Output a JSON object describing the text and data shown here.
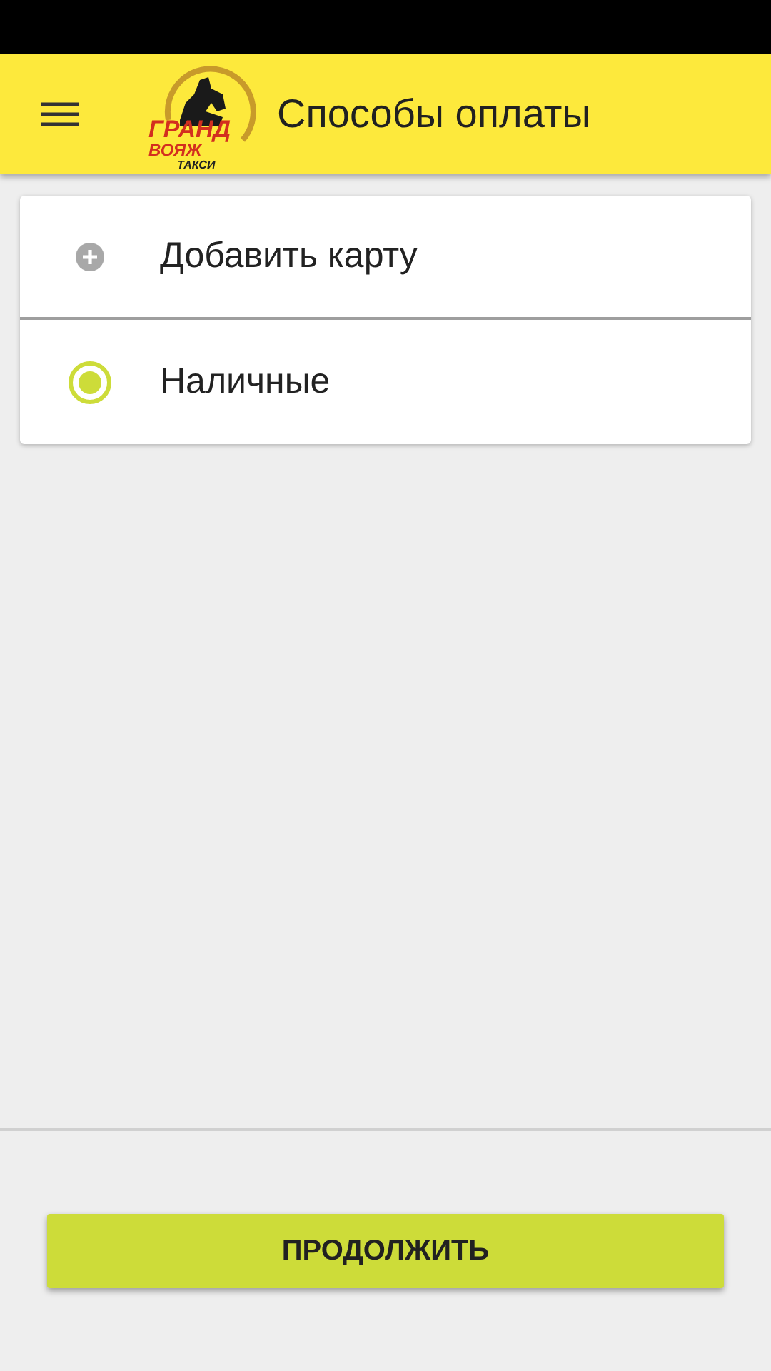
{
  "header": {
    "title": "Способы оплаты",
    "logo": {
      "line_1": "ГРАНД",
      "line_2": "ВОЯЖ",
      "line_3": "ТАКСИ"
    }
  },
  "payment_methods": [
    {
      "kind": "add",
      "label": "Добавить карту"
    },
    {
      "kind": "radio",
      "label": "Наличные",
      "selected": true
    }
  ],
  "continue_button": "ПРОДОЛЖИТЬ"
}
